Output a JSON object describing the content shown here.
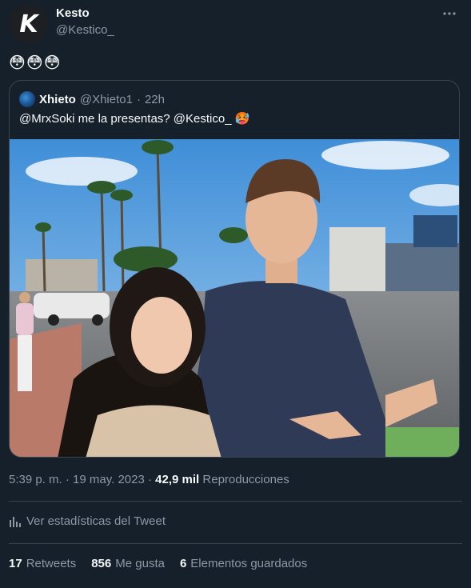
{
  "author": {
    "name": "Kesto",
    "handle": "@Kestico_",
    "avatar_letter": "K"
  },
  "tweet": {
    "text": "😳😳😳"
  },
  "quoted": {
    "name": "Xhieto",
    "handle": "@Xhieto1",
    "separator": "·",
    "time": "22h",
    "text": "@MrxSoki me la presentas? @Kestico_ 🥵",
    "image_description": "photo"
  },
  "meta": {
    "time": "5:39 p. m.",
    "dot1": "·",
    "date": "19 may. 2023",
    "dot2": "·",
    "views": "42,9 mil",
    "views_label": "Reproducciones"
  },
  "stats_link": "Ver estadísticas del Tweet",
  "counts": {
    "retweets": "17",
    "retweets_label": "Retweets",
    "likes": "856",
    "likes_label": "Me gusta",
    "bookmarks": "6",
    "bookmarks_label": "Elementos guardados"
  },
  "colors": {
    "background": "#15202b",
    "border": "#38444d",
    "secondary_text": "#8b98a5",
    "primary_text": "#f7f9f9"
  }
}
